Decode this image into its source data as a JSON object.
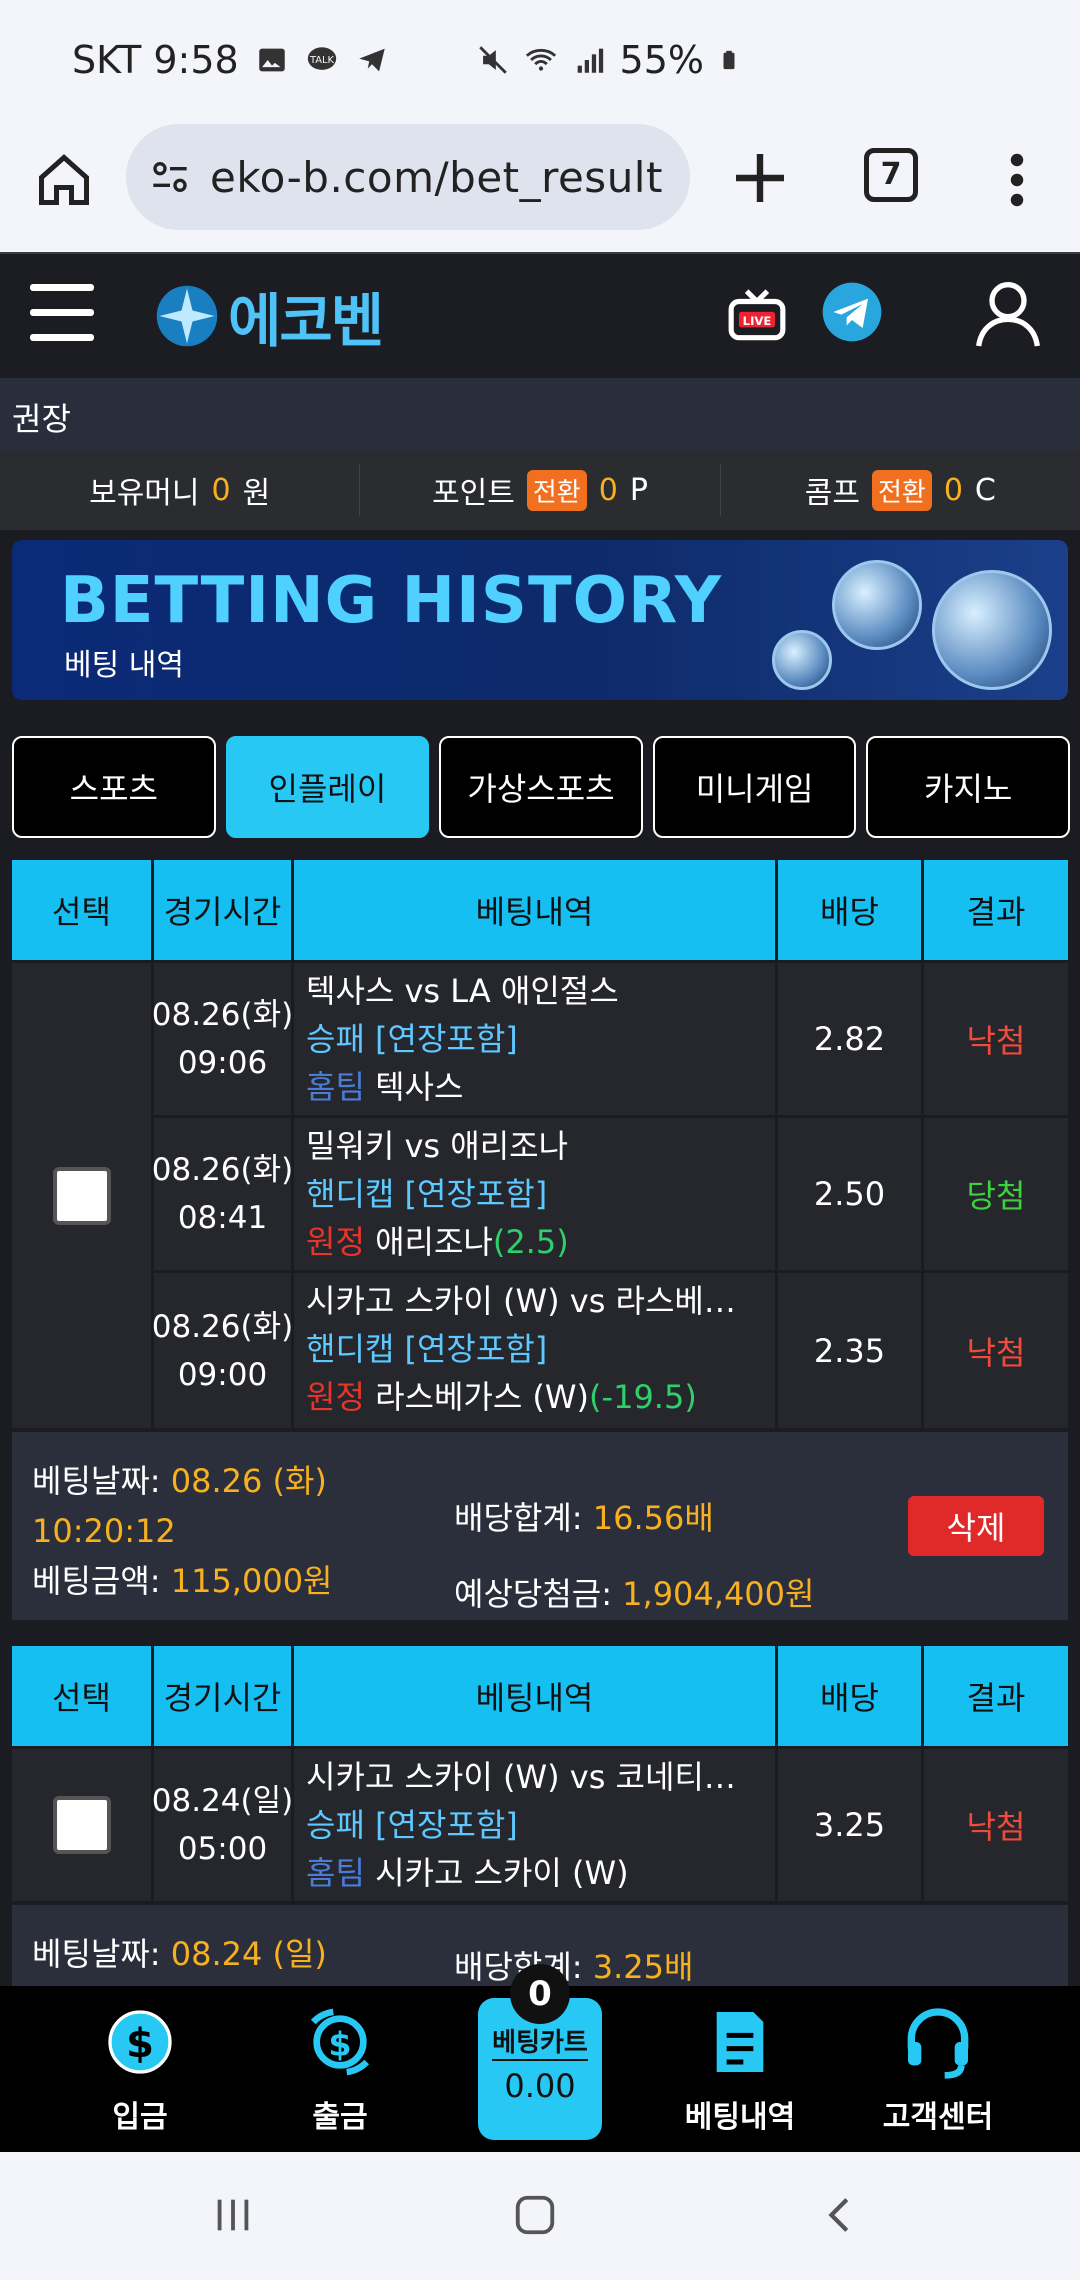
{
  "status_bar": {
    "carrier_time": "SKT 9:58",
    "battery": "55%"
  },
  "browser": {
    "url": "eko-b.com/bet_result",
    "tab_count": "7"
  },
  "site": {
    "logo_text": "에코벤"
  },
  "breadcrumb": "권장",
  "money_bar": {
    "balance_label": "보유머니",
    "balance_value": "0",
    "balance_unit": "원",
    "point_label": "포인트",
    "point_chip": "전환",
    "point_value": "0",
    "point_unit": "P",
    "comp_label": "콤프",
    "comp_chip": "전환",
    "comp_value": "0",
    "comp_unit": "C"
  },
  "banner": {
    "title": "BETTING HISTORY",
    "subtitle": "베팅 내역"
  },
  "tabs": [
    "스포츠",
    "인플레이",
    "가상스포츠",
    "미니게임",
    "카지노"
  ],
  "table_headers": [
    "선택",
    "경기시간",
    "베팅내역",
    "배당",
    "결과"
  ],
  "bet_groups": [
    {
      "rows": [
        {
          "date": "08.26(화)",
          "time": "09:06",
          "match": "텍사스 vs LA 애인절스",
          "market": "승패 [연장포함]",
          "pick_side": "홈팀",
          "pick": "텍사스",
          "line": "",
          "odds": "2.82",
          "result": "낙첨"
        },
        {
          "date": "08.26(화)",
          "time": "08:41",
          "match": "밀워키 vs 애리조나",
          "market": "핸디캡 [연장포함]",
          "pick_side": "원정",
          "pick": "애리조나",
          "line": "(2.5)",
          "odds": "2.50",
          "result": "당첨"
        },
        {
          "date": "08.26(화)",
          "time": "09:00",
          "match": "시카고 스카이 (W) vs 라스베…",
          "market": "핸디캡 [연장포함]",
          "pick_side": "원정",
          "pick": "라스베가스 (W)",
          "line": "(-19.5)",
          "odds": "2.35",
          "result": "낙첨"
        }
      ],
      "summary": {
        "bet_date_label": "베팅날짜:",
        "bet_date": "08.26 (화)",
        "bet_time": "10:20:12",
        "amount_label": "베팅금액:",
        "amount": "115,000원",
        "odds_total_label": "배당합계:",
        "odds_total": "16.56배",
        "expected_label": "예상당첨금:",
        "expected": "1,904,400원",
        "delete_label": "삭제"
      }
    },
    {
      "rows": [
        {
          "date": "08.24(일)",
          "time": "05:00",
          "match": "시카고 스카이 (W) vs 코네티…",
          "market": "승패 [연장포함]",
          "pick_side": "홈팀",
          "pick": "시카고 스카이 (W)",
          "line": "",
          "odds": "3.25",
          "result": "낙첨"
        }
      ],
      "summary": {
        "bet_date_label": "베팅날짜:",
        "bet_date": "08.24 (일)",
        "odds_total_label": "배당합계:",
        "odds_total": "3.25배"
      }
    }
  ],
  "bottom_nav": {
    "deposit": "입금",
    "withdraw": "출금",
    "history": "베팅내역",
    "support": "고객센터",
    "cart_label": "베팅카트",
    "cart_value": "0.00",
    "cart_count": "0"
  },
  "colors": {
    "accent": "#27c8f4",
    "lose": "#f04a3a",
    "win": "#3ad33a",
    "money": "#f6b020"
  }
}
